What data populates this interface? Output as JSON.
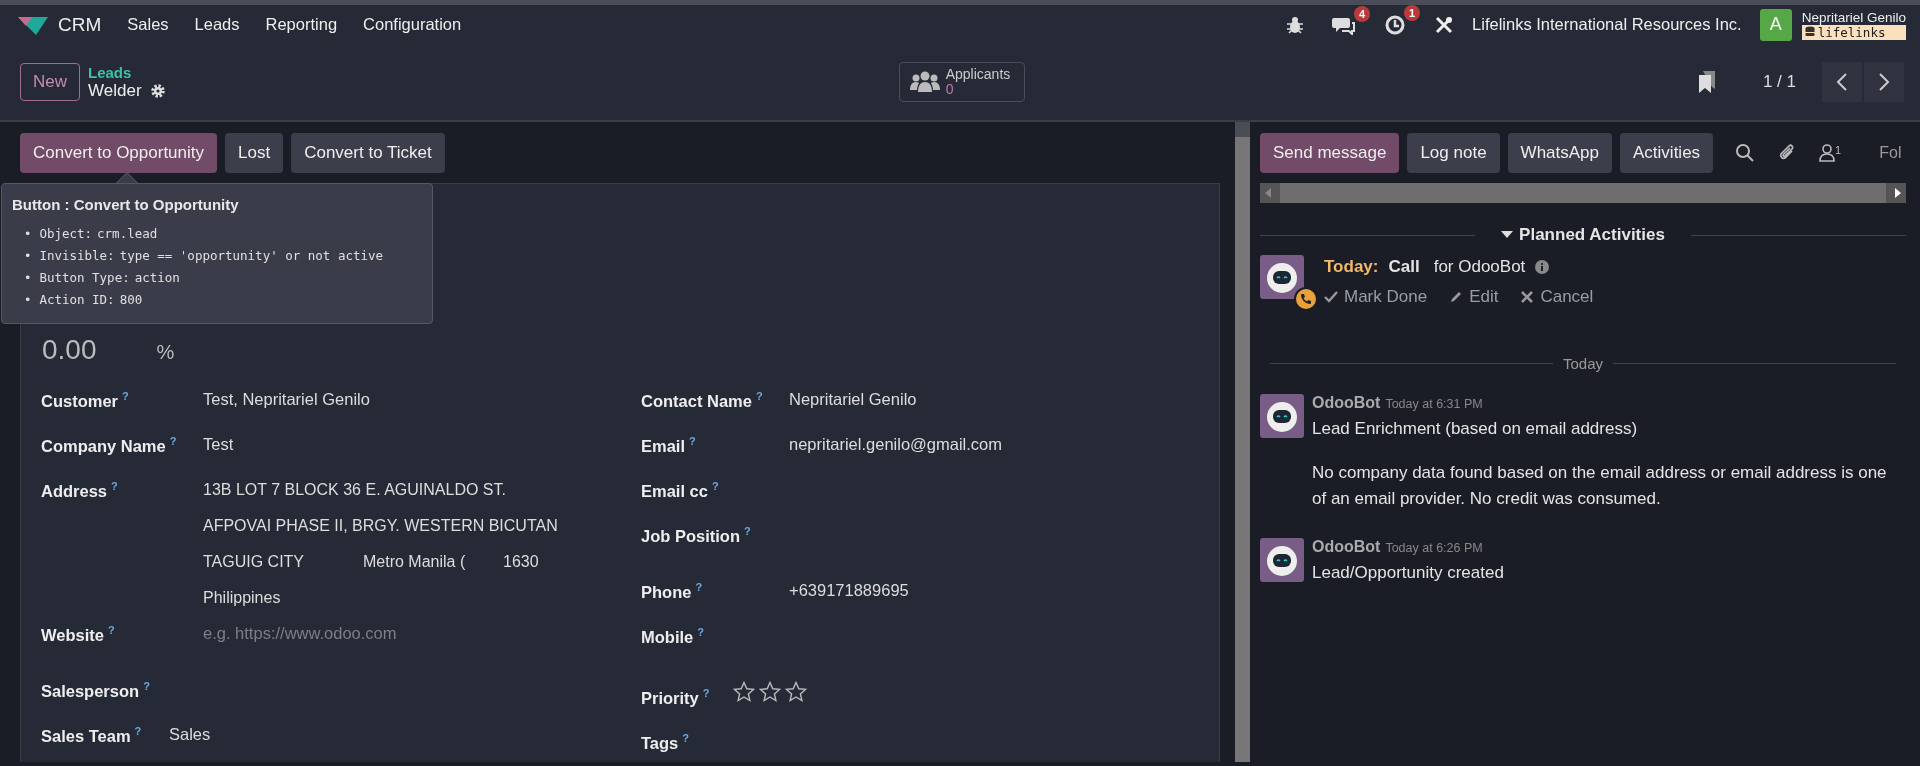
{
  "navbar": {
    "app_name": "CRM",
    "menu": [
      "Sales",
      "Leads",
      "Reporting",
      "Configuration"
    ],
    "message_count": "4",
    "activity_count": "1",
    "company": "Lifelinks International Resources Inc.",
    "user": {
      "initial": "A",
      "name": "Nepritariel Genilo",
      "database": "lifelinks"
    }
  },
  "control_panel": {
    "new_button": "New",
    "breadcrumb": "Leads",
    "record": "Welder",
    "applicants": {
      "label": "Applicants",
      "count": "0"
    },
    "pager": "1 / 1"
  },
  "actions": [
    {
      "label": "Convert to Opportunity",
      "primary": true
    },
    {
      "label": "Lost",
      "primary": false
    },
    {
      "label": "Convert to Ticket",
      "primary": false
    }
  ],
  "tooltip": {
    "title": "Button : Convert to Opportunity",
    "bullet": "•",
    "items": [
      {
        "key": "Object:",
        "value": "crm.lead"
      },
      {
        "key": "Invisible:",
        "value": "type == 'opportunity' or not active"
      },
      {
        "key": "Button Type:",
        "value": "action"
      },
      {
        "key": "Action ID:",
        "value": "800"
      }
    ]
  },
  "probability": {
    "value": "0.00",
    "unit": "%"
  },
  "left_fields": [
    {
      "label": "Customer",
      "kind": "text",
      "value": "Test, Nepritariel Genilo"
    },
    {
      "label": "Company Name",
      "kind": "text",
      "value": "Test"
    },
    {
      "label": "Address",
      "kind": "address",
      "street": "13B LOT 7 BLOCK 36 E. AGUINALDO ST.",
      "street2": "AFPOVAI PHASE II, BRGY. WESTERN BICUTAN",
      "city": "TAGUIG CITY",
      "state": "Metro Manila (",
      "zip": "1630",
      "country": "Philippines"
    },
    {
      "label": "Website",
      "kind": "placeholder",
      "placeholder": "e.g. https://www.odoo.com"
    },
    {
      "label": "Salesperson",
      "kind": "empty"
    },
    {
      "label": "Sales Team",
      "kind": "tight",
      "value": "Sales"
    }
  ],
  "right_fields": [
    {
      "label": "Contact Name",
      "kind": "text",
      "value": "Nepritariel Genilo"
    },
    {
      "label": "Email",
      "kind": "text",
      "value": "nepritariel.genilo@gmail.com"
    },
    {
      "label": "Email cc",
      "kind": "empty"
    },
    {
      "label": "Job Position",
      "kind": "empty"
    },
    {
      "label": "Phone",
      "kind": "text",
      "value": "+639171889695"
    },
    {
      "label": "Mobile",
      "kind": "empty"
    },
    {
      "label": "Priority",
      "kind": "stars",
      "stars": 0
    },
    {
      "label": "Tags",
      "kind": "empty"
    }
  ],
  "help_mark": "?",
  "chatter": {
    "buttons": [
      {
        "label": "Send message",
        "primary": true
      },
      {
        "label": "Log note",
        "primary": false
      },
      {
        "label": "WhatsApp",
        "primary": false
      },
      {
        "label": "Activities",
        "primary": false
      }
    ],
    "follower_count": "1",
    "follow": "Fol",
    "planned_title": "Planned Activities",
    "activity": {
      "when": "Today:",
      "type": "Call",
      "for": "for OdooBot",
      "actions": [
        "Mark Done",
        "Edit",
        "Cancel"
      ]
    },
    "divider": "Today",
    "messages": [
      {
        "author": "OdooBot",
        "time": "Today at 6:31 PM",
        "paragraphs": [
          "Lead Enrichment (based on email address)",
          "No company data found based on the email address or email address is one of an email provider. No credit was consumed."
        ]
      },
      {
        "author": "OdooBot",
        "time": "Today at 6:26 PM",
        "paragraphs": [
          "Lead/Opportunity created"
        ]
      }
    ]
  }
}
